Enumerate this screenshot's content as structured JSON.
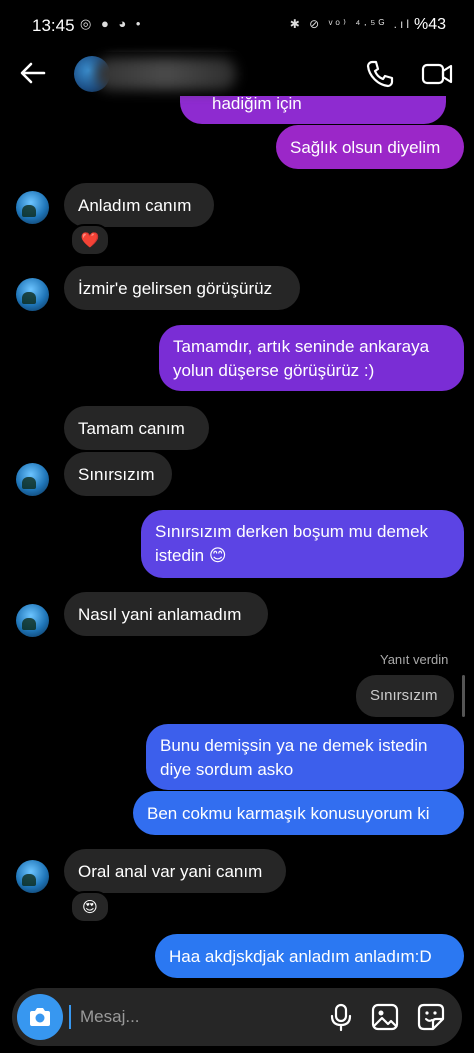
{
  "status_bar": {
    "time": "13:45",
    "left_icons": "◎ ● ◕ •",
    "right_icons": "✱ ⊘ ᵛᵒ⁾ ⁴·⁵ᴳ .ıl",
    "battery": "%43"
  },
  "header": {
    "back_icon": "arrow-left-icon",
    "call_icon": "phone-icon",
    "video_icon": "video-camera-icon",
    "partial_message": "hadiğim için"
  },
  "messages": [
    {
      "dir": "out",
      "text": "Sağlık olsun diyelim"
    },
    {
      "dir": "in",
      "text": "Anladım canım",
      "reaction": "❤️"
    },
    {
      "dir": "in",
      "text": "İzmir'e gelirsen görüşürüz"
    },
    {
      "dir": "out",
      "text": "Tamamdır, artık seninde ankaraya yolun düşerse görüşürüz :)"
    },
    {
      "dir": "in",
      "text": "Tamam canım"
    },
    {
      "dir": "in",
      "text": "Sınırsızım"
    },
    {
      "dir": "out",
      "text": "Sınırsızım derken boşum mu demek istedin 😊"
    },
    {
      "dir": "in",
      "text": "Nasıl yani anlamadım"
    },
    {
      "dir": "out",
      "text": "Bunu demişsin ya ne demek istedin diye sordum asko"
    },
    {
      "dir": "out",
      "text": "Ben cokmu karmaşık konusuyorum ki"
    },
    {
      "dir": "in",
      "text": "Oral anal var yani canım",
      "reaction": "😍"
    },
    {
      "dir": "out",
      "text": "Haa akdjskdjak anladım anladım:D"
    }
  ],
  "reply": {
    "label": "Yanıt verdin",
    "quoted": "Sınırsızım"
  },
  "composer": {
    "placeholder": "Mesaj...",
    "camera_icon": "camera-icon",
    "mic_icon": "microphone-icon",
    "gallery_icon": "image-icon",
    "sticker_icon": "sticker-icon"
  },
  "colors": {
    "bubble_in": "#262626",
    "purple": "#9c27c9",
    "violet": "#7b2fd9",
    "indigo": "#5b42e6",
    "blue": "#2f6ff0",
    "accent": "#3797f0"
  }
}
